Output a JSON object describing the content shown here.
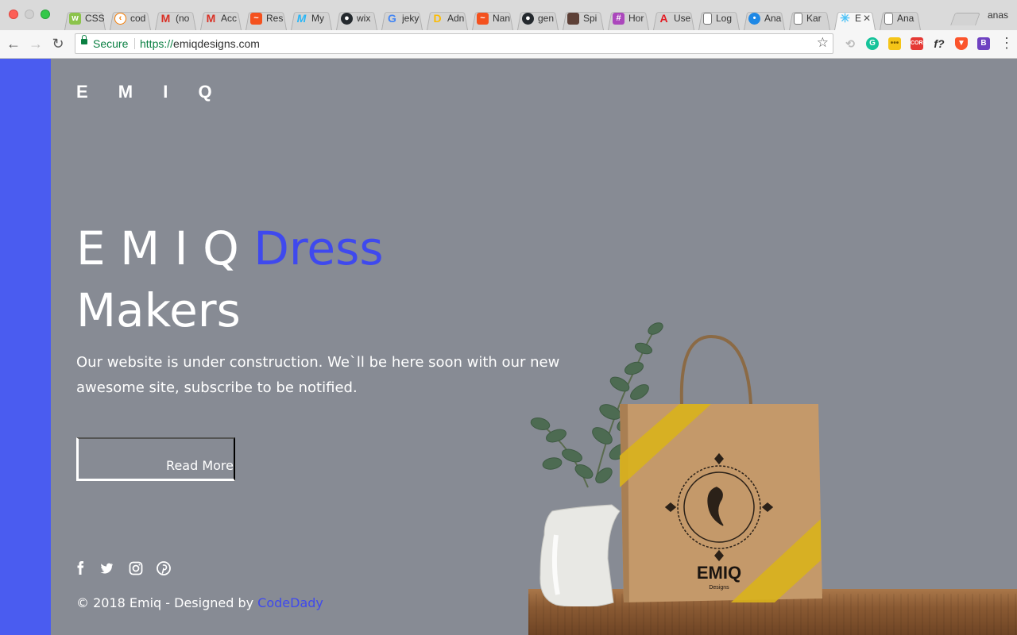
{
  "browser": {
    "tabs": [
      {
        "label": "CSS",
        "icon": "w3schools-icon",
        "color": "#8bc34a"
      },
      {
        "label": "cod",
        "icon": "codepen-circle-icon",
        "color": "#f57c00"
      },
      {
        "label": "(no",
        "icon": "gmail-icon",
        "color": "#d93025"
      },
      {
        "label": "Acc",
        "icon": "gmail-icon",
        "color": "#d93025"
      },
      {
        "label": "Res",
        "icon": "orange-zigzag-icon",
        "color": "#f4511e"
      },
      {
        "label": "My",
        "icon": "blue-m-icon",
        "color": "#29b6f6"
      },
      {
        "label": "wix",
        "icon": "github-icon",
        "color": "#24292e"
      },
      {
        "label": "jeky",
        "icon": "google-icon",
        "color": "#4285f4"
      },
      {
        "label": "Adn",
        "icon": "adsense-icon",
        "color": "#fbbc05"
      },
      {
        "label": "Nan",
        "icon": "orange-zigzag-icon",
        "color": "#f4511e"
      },
      {
        "label": "gen",
        "icon": "github-icon",
        "color": "#24292e"
      },
      {
        "label": "Spi",
        "icon": "book-icon",
        "color": "#5d4037"
      },
      {
        "label": "Hor",
        "icon": "purple-grid-icon",
        "color": "#ab47bc"
      },
      {
        "label": "Use",
        "icon": "adobe-icon",
        "color": "#e31b23"
      },
      {
        "label": "Log",
        "icon": "document-icon",
        "color": "#9e9e9e"
      },
      {
        "label": "Ana",
        "icon": "drop-icon",
        "color": "#1e88e5"
      },
      {
        "label": "Kar",
        "icon": "document-icon",
        "color": "#9e9e9e"
      },
      {
        "label": "E",
        "icon": "sparkle-icon",
        "color": "#4fc3f7",
        "active": true
      },
      {
        "label": "Ana",
        "icon": "document-icon",
        "color": "#9e9e9e"
      }
    ],
    "profile": "anas",
    "secure_label": "Secure",
    "url_scheme": "https://",
    "url_host": "emiqdesigns.com"
  },
  "page": {
    "logo": "E M I Q",
    "hero_line1_plain": "E M I Q ",
    "hero_line1_accent": "Dress",
    "hero_line2": "Makers",
    "description": "Our website is under construction. We`ll be here soon with our new awesome site, subscribe to be notified.",
    "read_more": "Read More",
    "copyright_prefix": "© 2018 Emiq - Designed by ",
    "copyright_link": "CodeDady",
    "bag_brand": "EMIQ",
    "bag_sub": "Designs",
    "colors": {
      "background": "#878b94",
      "accent": "#3f49ee",
      "side_strip": "#4a5cf0"
    }
  }
}
